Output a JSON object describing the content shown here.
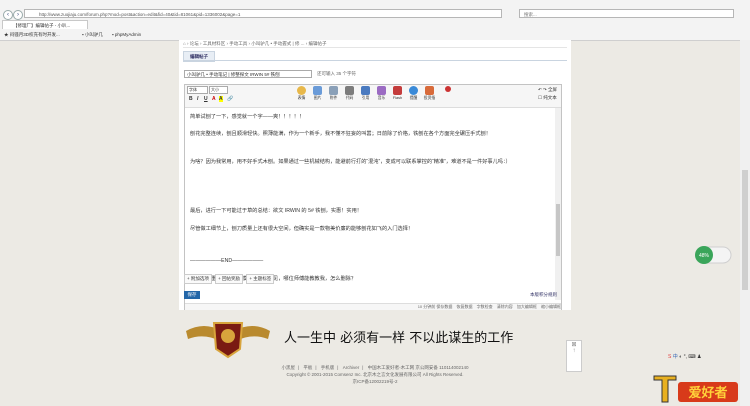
{
  "browser": {
    "url": "http://www.zuojiaju.com/forum.php?mod=post&action=edit&fid=40&tid=81061&pid=1336002&page=1",
    "search_placeholder": "搜索...",
    "tab_title": "【修理厂】编辑帖子 - 小叭...",
    "favorites": [
      "闷骚月3D校充有时开发...",
      "小叫驴几",
      "phpMyAdmin"
    ]
  },
  "breadcrumb": [
    "论坛",
    "工具材料区",
    "手动工具",
    "小叫驴几 • 手动握式 | 修 ...",
    "编辑帖子"
  ],
  "section_tab": "编辑帖子",
  "post": {
    "title_value": "小叫驴几 • 手动笔记 | 修整探文 IRWIN 5# 铁刨",
    "title_hint": "还可输入 35 个字符"
  },
  "editor": {
    "font_select": "字体",
    "size_select": "大小",
    "format_buttons": [
      "B",
      "I",
      "U",
      "A",
      "A",
      "🔗"
    ],
    "tools": [
      {
        "label": "表情",
        "color": "#e8b84a"
      },
      {
        "label": "图片",
        "color": "#6a9bd8"
      },
      {
        "label": "附件",
        "color": "#8aa0b8"
      },
      {
        "label": "代码",
        "color": "#7c7c7c"
      },
      {
        "label": "引用",
        "color": "#4a7ac0"
      },
      {
        "label": "音乐",
        "color": "#9b6bc3"
      },
      {
        "label": "Flash",
        "color": "#c43c3c"
      },
      {
        "label": "提醒",
        "color": "#3a8ad8"
      },
      {
        "label": "投资指",
        "color": "#d86a3a"
      },
      {
        "label": "",
        "color": "#c33"
      }
    ],
    "options": {
      "advanced": "全屏",
      "plain": "纯文本"
    },
    "paragraphs": [
      "简单试刨了一下，感觉就一个字——爽！！！！！",
      "刨花完整连续，刨且顺滑轻快。照薄能满，作为一个新手，我不懂不狂妄的叫嚣；日前除了价格，铁刨在各个方面完全碾压手式刨！",
      "为啥？因为我常用，用不好手式木刨。如果通过一些机械结构，能避前行打的“混沌”，变成可以联系掌控的“精准”，难道不是一件好事儿吗：）",
      "最后，进行一下可能过于草的总结：欲文 IRWIN 的 5# 铁刨，实惠！实用！",
      "尽管做工细节上，刨刀质量上还有很大空间，但确实是一款物美价廉的能够刨花如飞的入门选择！",
      "——————END——————",
      "以下图片重复，但编辑模式下并不可见，哪位师傅能教教我，怎么删除？"
    ],
    "status": [
      "10 分钟前 保存数据",
      "恢复数据",
      "字数检查",
      "清除内容",
      "加大编辑框",
      "缩小编辑框"
    ]
  },
  "post_options": [
    "附加选项",
    "回帖奖励",
    "主题标签"
  ],
  "submit_label": "保存",
  "credit_rules": "本版积分规则",
  "slogan": "人一生中 必须有一样 不以此谋生的工作",
  "footer": {
    "links": [
      "小黑屋",
      "平板",
      "手机版",
      "Archiver"
    ],
    "icp": "中国木工爱好者-木工网 京公网安备 110114002140",
    "copyright": "Copyright © 2001-2015 Comsenz Inc. 北京木之言文化发展有限公司 All Rights Reserved.",
    "beian": "京ICP备12002219号-2"
  },
  "widget_percent": "48%",
  "brand_text": "木工爱好者"
}
